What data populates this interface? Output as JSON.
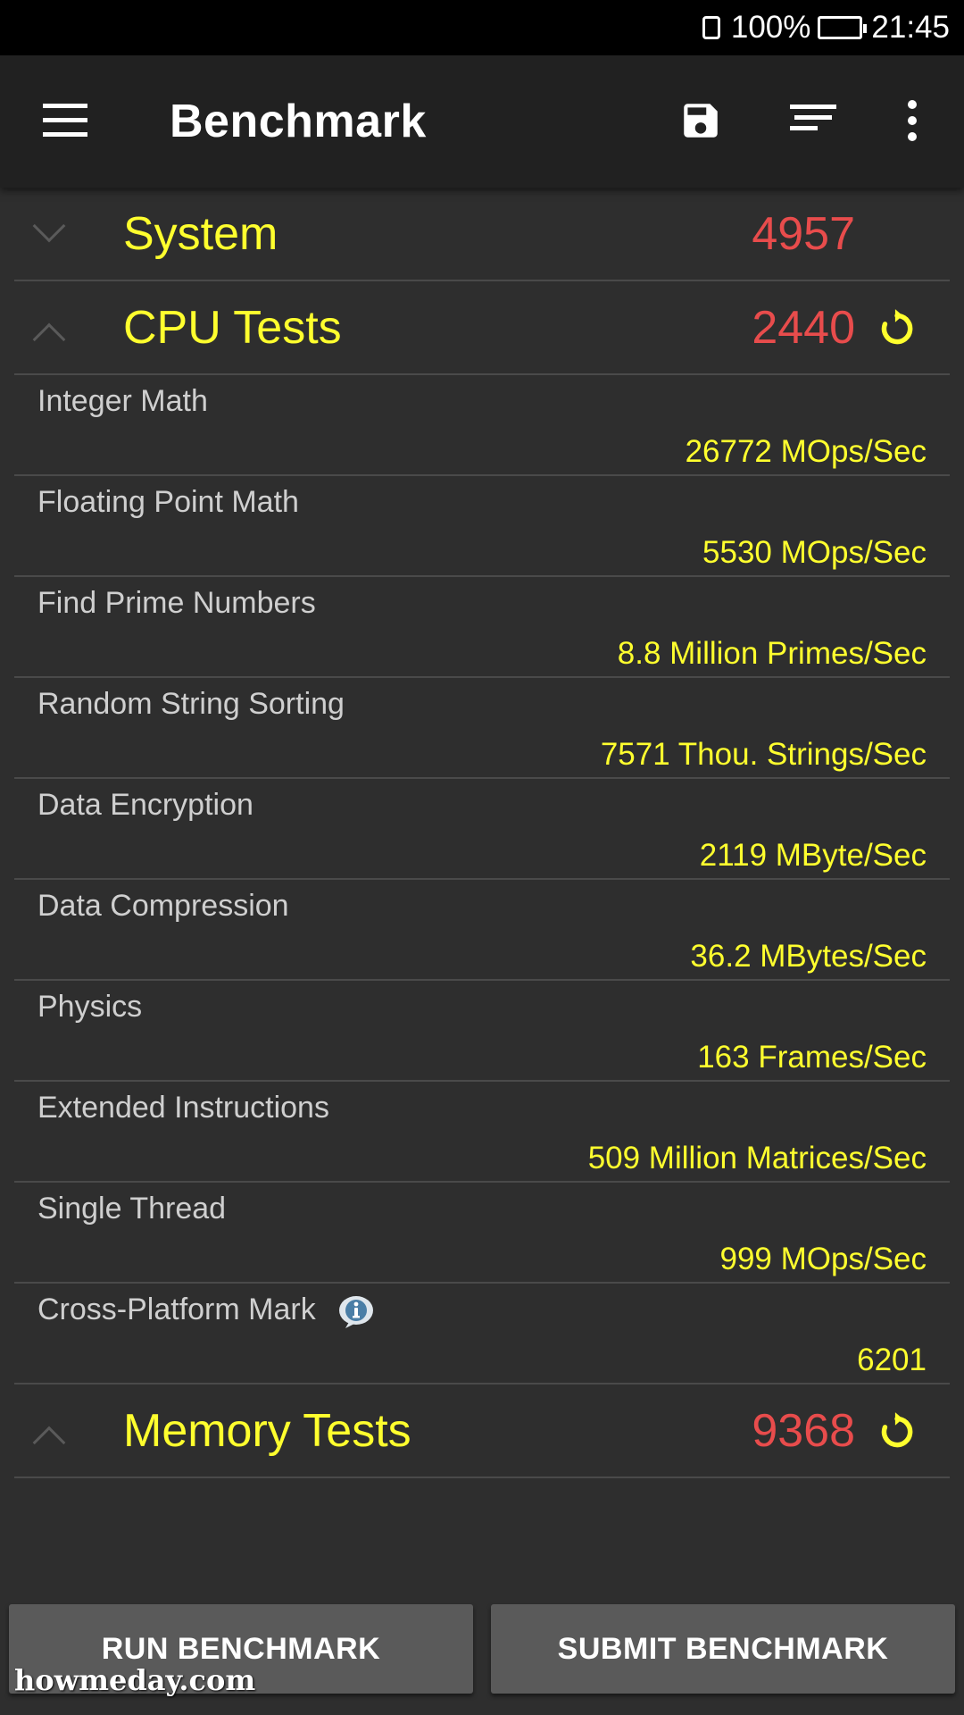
{
  "status_bar": {
    "battery": "100%",
    "time": "21:45"
  },
  "app_bar": {
    "title": "Benchmark"
  },
  "sections": {
    "system": {
      "title": "System",
      "score": "4957"
    },
    "cpu": {
      "title": "CPU Tests",
      "score": "2440"
    },
    "memory": {
      "title": "Memory Tests",
      "score": "9368"
    }
  },
  "cpu_tests": [
    {
      "name": "Integer Math",
      "value": "26772 MOps/Sec"
    },
    {
      "name": "Floating Point Math",
      "value": "5530 MOps/Sec"
    },
    {
      "name": "Find Prime Numbers",
      "value": "8.8 Million Primes/Sec"
    },
    {
      "name": "Random String Sorting",
      "value": "7571 Thou. Strings/Sec"
    },
    {
      "name": "Data Encryption",
      "value": "2119 MByte/Sec"
    },
    {
      "name": "Data Compression",
      "value": "36.2 MBytes/Sec"
    },
    {
      "name": "Physics",
      "value": "163 Frames/Sec"
    },
    {
      "name": "Extended Instructions",
      "value": "509 Million Matrices/Sec"
    },
    {
      "name": "Single Thread",
      "value": "999 MOps/Sec"
    },
    {
      "name": "Cross-Platform Mark",
      "value": "6201"
    }
  ],
  "buttons": {
    "run": "RUN BENCHMARK",
    "submit": "SUBMIT BENCHMARK"
  },
  "watermark": "howmeday.com",
  "colors": {
    "accent_yellow": "#ffff2e",
    "score_red": "#e84c4c",
    "background": "#2e2e2e",
    "app_bar": "#212121"
  },
  "icons": [
    "menu-icon",
    "save-icon",
    "sort-icon",
    "more-vert-icon",
    "chevron-down-icon",
    "chevron-up-icon",
    "refresh-icon",
    "info-icon"
  ]
}
